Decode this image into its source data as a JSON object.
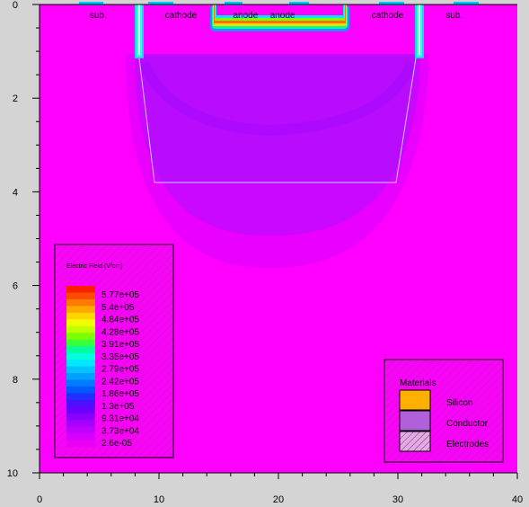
{
  "chart_data": {
    "type": "heatmap",
    "xlim": [
      0,
      40
    ],
    "ylim": [
      0,
      10
    ],
    "y_inverted": true,
    "x_ticks": [
      0,
      10,
      20,
      30,
      40
    ],
    "y_ticks": [
      0,
      2,
      4,
      6,
      8,
      10
    ],
    "electrodes": [
      {
        "label": "sub.",
        "x": 4.2
      },
      {
        "label": "cathode",
        "x": 10.5
      },
      {
        "label": "anode",
        "x": 16.2
      },
      {
        "label": "anode",
        "x": 19.3
      },
      {
        "label": "cathode",
        "x": 27.8
      },
      {
        "label": "sub.",
        "x": 34.0
      }
    ],
    "colorbar": {
      "title": "Electric Field (V/cm)",
      "labels": [
        "5.77e+05",
        "5.4e+05",
        "4.84e+05",
        "4.28e+05",
        "3.91e+05",
        "3.35e+05",
        "2.79e+05",
        "2.42e+05",
        "1.86e+05",
        "1.3e+05",
        "9.31e+04",
        "3.73e+04",
        "2.6e-05"
      ],
      "colors": [
        "#ff1e00",
        "#ff4a00",
        "#ff7a00",
        "#ffa800",
        "#ffd400",
        "#f0ff00",
        "#bfff00",
        "#7cff00",
        "#3cff3c",
        "#00ff9a",
        "#00ffd8",
        "#00e8ff",
        "#00c4ff",
        "#00a0ff",
        "#007cff",
        "#0058ff",
        "#2030ff",
        "#4a10ff",
        "#6a00ff",
        "#8a00ff",
        "#a800ff",
        "#c000ff",
        "#d600ff",
        "#e800f0"
      ]
    },
    "materials": {
      "title": "Materials",
      "items": [
        {
          "name": "Silicon",
          "color": "#ffb000"
        },
        {
          "name": "Conductor",
          "color": "#b060d8"
        },
        {
          "name": "Electrodes",
          "color": "hatched"
        }
      ]
    },
    "colors": {
      "background": "#ff00ff",
      "window": "#d4d4d4"
    }
  }
}
